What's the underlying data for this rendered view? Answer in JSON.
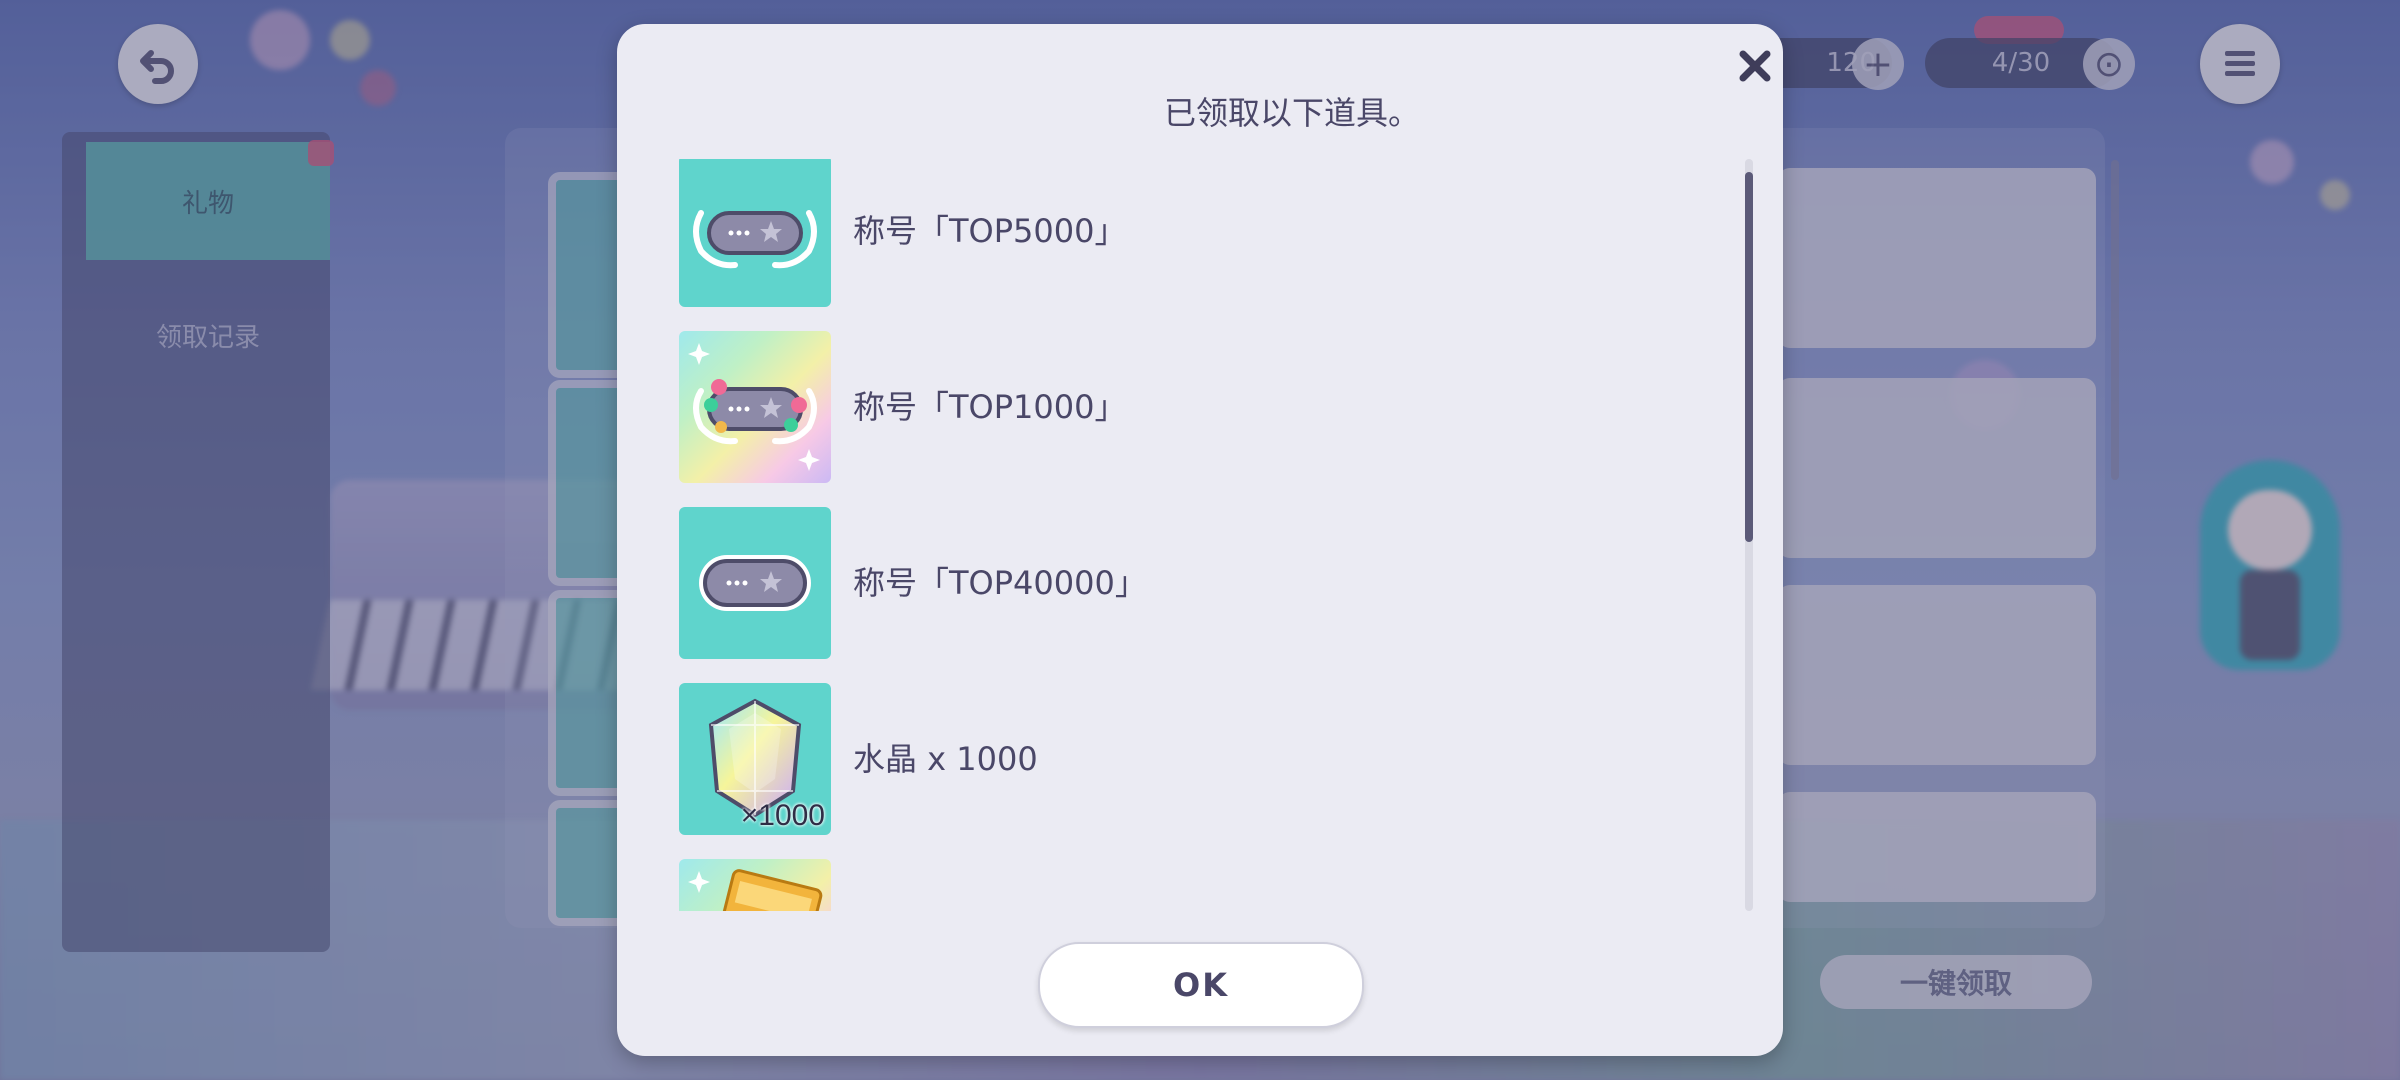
{
  "background": {
    "left_tabs": [
      {
        "label": "礼物"
      },
      {
        "label": "领取记录"
      }
    ],
    "currency": [
      {
        "value": "120"
      },
      {
        "value": "4/30"
      }
    ],
    "claim_all_label": "一键领取"
  },
  "dialog": {
    "title": "已领取以下道具。",
    "ok_label": "OK",
    "items": [
      {
        "label": "称号「TOP5000」",
        "icon": "title-plate-laurel-icon"
      },
      {
        "label": "称号「TOP1000」",
        "icon": "title-plate-flower-icon"
      },
      {
        "label": "称号「TOP40000」",
        "icon": "title-plate-plain-icon"
      },
      {
        "label": "水晶 x 1000",
        "icon": "crystal-icon",
        "quantity": "×1000"
      },
      {
        "label": "",
        "icon": "skill-ticket-icon"
      }
    ]
  },
  "colors": {
    "accent_teal": "#5fd4cc",
    "dialog_bg": "#ebebf3",
    "text": "#4a4768"
  }
}
